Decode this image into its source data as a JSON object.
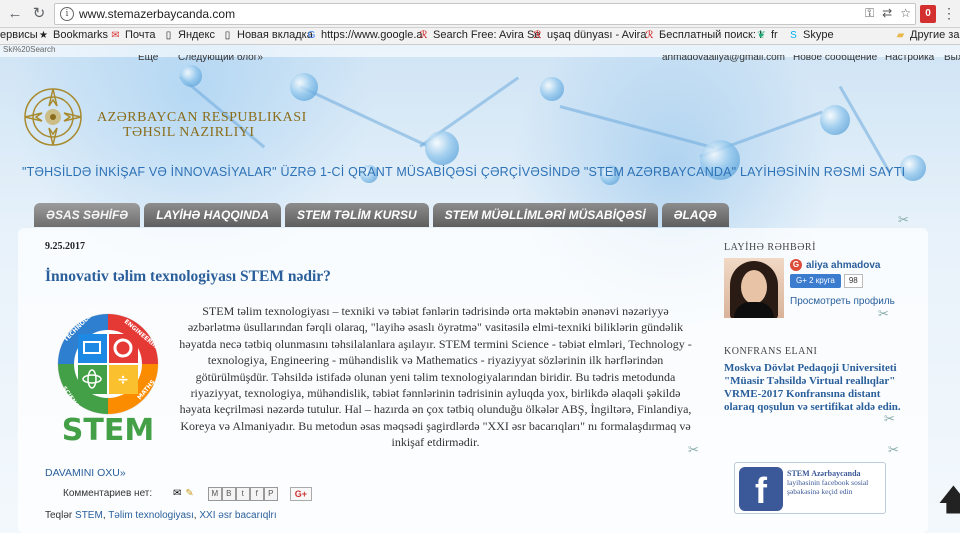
{
  "browser": {
    "url": "www.stemazerbaycanda.com",
    "menu_icon": "kebab-menu-icon",
    "extension_badge": "0"
  },
  "bookmarks": [
    {
      "label": "ервисы",
      "icon": "apps-icon"
    },
    {
      "label": "Bookmarks",
      "icon": "star-icon"
    },
    {
      "label": "Почта",
      "icon": "mail-icon"
    },
    {
      "label": "Яндекс",
      "icon": "page-icon"
    },
    {
      "label": "Новая вкладка",
      "icon": "page-icon"
    },
    {
      "label": "https://www.google.a",
      "icon": "google-icon"
    },
    {
      "label": "Search Free: Avira Se",
      "icon": "avira-icon"
    },
    {
      "label": "uşaq dünyası - Avira",
      "icon": "avira-icon"
    },
    {
      "label": "Бесплатный поиск: I",
      "icon": "avira-icon"
    },
    {
      "label": "fr",
      "icon": "leaf-icon"
    },
    {
      "label": "Skype",
      "icon": "skype-icon"
    },
    {
      "label": "Другие закл",
      "icon": "folder-icon"
    }
  ],
  "search_strip": "Ski%20Search",
  "blogger_bar": {
    "left1": "Еще",
    "left2": "Следующий блог»",
    "email": "ahmadovaaliya@gmail.com",
    "new_post": "Новое сообщение",
    "settings": "Настройка",
    "exit": "Вых"
  },
  "ministry": {
    "line1": "AZƏRBAYCAN RESPUBLIKASI",
    "line2": "TƏHSIL NAZIRLIYI"
  },
  "project_title": "\"TƏHSİLDƏ İNKİŞAF VƏ İNNOVASİYALAR\" ÜZRƏ 1-Cİ QRANT MÜSABİQƏSİ ÇƏRÇİVƏSİNDƏ \"STEM AZƏRBAYCANDA\" LAYİHƏSİNİN RƏSMİ SAYTI",
  "nav_tabs": [
    {
      "label": "ƏSAS SƏHİFƏ",
      "active": true
    },
    {
      "label": "LAYİHƏ HAQQINDA",
      "active": false
    },
    {
      "label": "STEM TƏLİM KURSU",
      "active": false
    },
    {
      "label": "STEM MÜƏLLİMLƏRİ MÜSABİQƏSİ",
      "active": false
    },
    {
      "label": "ƏLAQƏ",
      "active": false
    }
  ],
  "post": {
    "date": "9.25.2017",
    "title": "İnnovativ təlim texnologiyası STEM nədir?",
    "stem_logo": {
      "ring_top_left": "TECHNOLOGY",
      "ring_top_right": "ENGINEERING",
      "ring_bottom_left": "SCIENCE",
      "ring_bottom_right": "MATHS",
      "wordmark": "STEM"
    },
    "body": "STEM təlim texnologiyası – texniki və təbiət fənlərin tədrisində orta məktəbin ənənəvi nəzəriyyə əzbərlətmə üsullarından fərqli olaraq, \"layihə əsaslı öyrətmə\" vasitəsilə elmi-texniki biliklərin gündəlik həyatda necə tətbiq olunmasını təhsilalanlara aşılayır. STEM termini Science - təbiət elmləri, Technology - texnologiya, Engineering - mühəndislik və Mathematics - riyaziyyat sözlərinin ilk hərflərindən götürülmüşdür. Təhsildə istifadə olunan yeni təlim texnologiyalarından biridir. Bu tədris metodunda riyaziyyat, texnologiya, mühəndislik, təbiət fənnlərinin tədrisinin ayluqda yox, birlikdə əlaqəli şəkildə həyata keçrilməsi nəzərdə tutulur. Hal – hazırda ən çox tətbiq olunduğu ölkələr ABŞ, İngiltərə, Finlandiya, Koreya və Almaniyadır. Bu metodun əsas məqsədi şagirdlərdə \"XXI əsr bacarıqları\" nı formalaşdırmaq və inkişaf etdirmədir.",
    "read_more": "DAVAMINI OXU»",
    "comments_label": "Комментариев нет:",
    "share_buttons": [
      "M",
      "B",
      "t",
      "f",
      "P"
    ],
    "gplus_label": "G+",
    "labels_prefix": "Teqlər",
    "labels": [
      "STEM",
      "Təlim texnologiyası",
      "XXI əsr bacarıqlrı"
    ]
  },
  "sidebar": {
    "leader_heading": "LAYİHƏ RƏHBƏRİ",
    "profile_name": "aliya ahmadova",
    "circles_button": "2 круга",
    "circles_count": "98",
    "view_profile": "Просмотреть профиль",
    "conference_heading": "KONFRANS ELANI",
    "conference_text": "Moskva Dövlət Pedaqoji Universiteti \"Müasir Təhsildə Virtual reallıqlar\" VRME-2017 Konfransına distant olaraq qoşulun və sertifikat əldə edin.",
    "fb_title": "STEM Azərbaycanda",
    "fb_text": "layihəsinin facebook sosial şəbəkəsinə keçid edin"
  },
  "colors": {
    "link": "#2a5f9b",
    "title_blue": "#2e72b6",
    "ministry_gold": "#8a6d1a",
    "tab_gray": "#6e6e6e",
    "facebook": "#3b5998"
  }
}
